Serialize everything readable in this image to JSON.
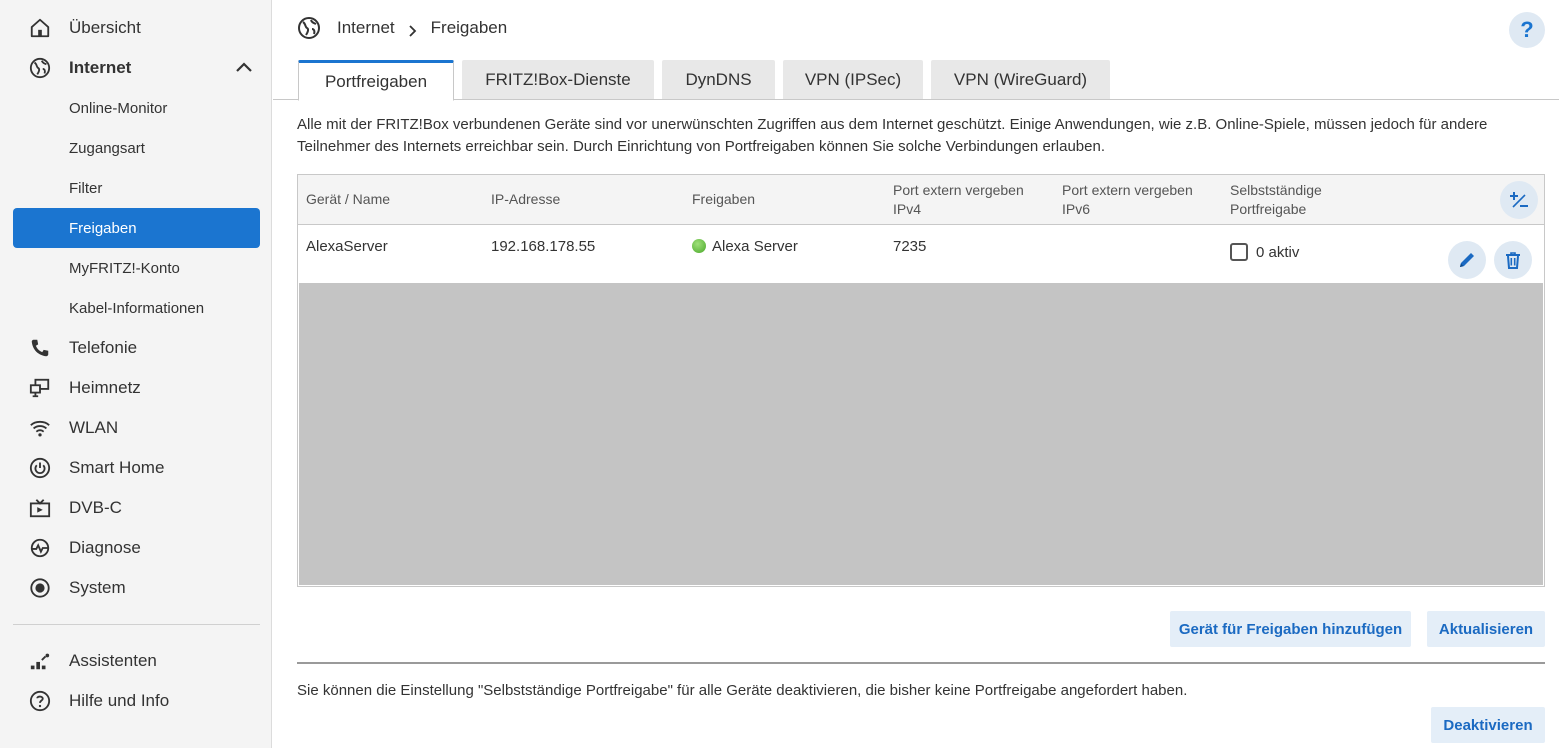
{
  "sidebar": {
    "items": [
      {
        "label": "Übersicht",
        "icon": "home-icon"
      },
      {
        "label": "Internet",
        "icon": "globe-icon",
        "expanded": true
      },
      {
        "label": "Telefonie",
        "icon": "phone-icon"
      },
      {
        "label": "Heimnetz",
        "icon": "network-icon"
      },
      {
        "label": "WLAN",
        "icon": "wifi-icon"
      },
      {
        "label": "Smart Home",
        "icon": "power-icon"
      },
      {
        "label": "DVB-C",
        "icon": "tv-icon"
      },
      {
        "label": "Diagnose",
        "icon": "diagnose-icon"
      },
      {
        "label": "System",
        "icon": "system-icon"
      },
      {
        "label": "Assistenten",
        "icon": "assistant-icon"
      },
      {
        "label": "Hilfe und Info",
        "icon": "help-icon"
      }
    ],
    "subitems": [
      {
        "label": "Online-Monitor"
      },
      {
        "label": "Zugangsart"
      },
      {
        "label": "Filter"
      },
      {
        "label": "Freigaben",
        "active": true
      },
      {
        "label": "MyFRITZ!-Konto"
      },
      {
        "label": "Kabel-Informationen"
      }
    ]
  },
  "breadcrumb": {
    "section": "Internet",
    "page": "Freigaben"
  },
  "help_label": "?",
  "tabs": [
    {
      "label": "Portfreigaben",
      "active": true
    },
    {
      "label": "FRITZ!Box-Dienste"
    },
    {
      "label": "DynDNS"
    },
    {
      "label": "VPN (IPSec)"
    },
    {
      "label": "VPN (WireGuard)"
    }
  ],
  "intro_text": "Alle mit der FRITZ!Box verbundenen Geräte sind vor unerwünschten Zugriffen aus dem Internet geschützt. Einige Anwendungen, wie z.B. Online-Spiele, müssen jedoch für andere Teilnehmer des Internets erreichbar sein. Durch Einrichtung von Portfreigaben können Sie solche Verbindungen erlauben.",
  "table": {
    "headers": {
      "device": "Gerät / Name",
      "ip": "IP-Adresse",
      "shares": "Freigaben",
      "port_ipv4": "Port extern vergeben IPv4",
      "port_ipv6": "Port extern vergeben IPv6",
      "self": "Selbstständige Portfreigabe"
    },
    "rows": [
      {
        "device": "AlexaServer",
        "ip": "192.168.178.55",
        "share": "Alexa Server",
        "share_status_color": "#4aa82a",
        "port_ipv4": "7235",
        "port_ipv6": "",
        "self_checked": false,
        "self_label": "0 aktiv"
      }
    ]
  },
  "buttons": {
    "add_device": "Gerät für Freigaben hinzufügen",
    "refresh": "Aktualisieren",
    "deactivate": "Deaktivieren"
  },
  "note_text": "Sie können die Einstellung \"Selbstständige Portfreigabe\" für alle Geräte deaktivieren, die bisher keine Portfreigabe angefordert haben.",
  "colors": {
    "accent": "#1b75d0",
    "button_bg": "#e4eef8",
    "sidebar_bg": "#f4f4f4"
  }
}
